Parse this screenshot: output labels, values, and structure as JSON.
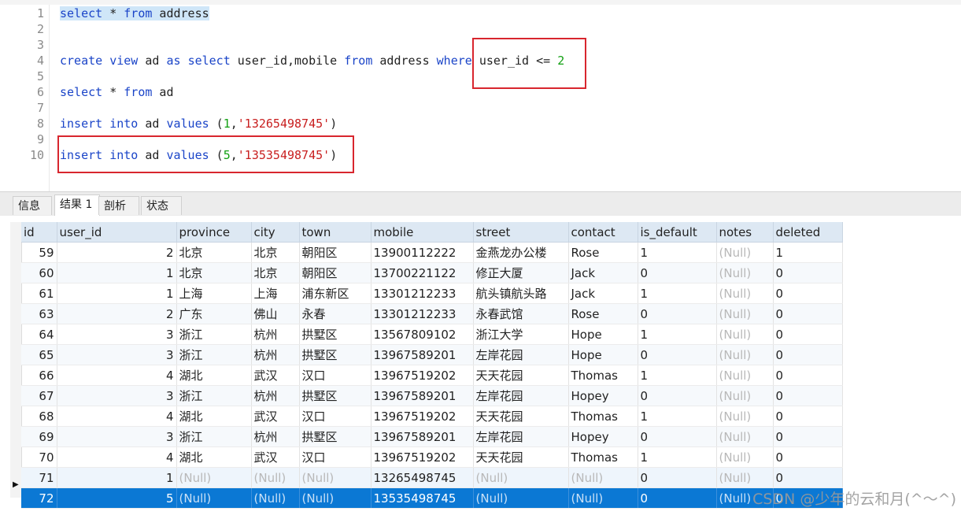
{
  "editor": {
    "lines": [
      {
        "n": "1",
        "segments": [
          [
            "kw",
            "select"
          ],
          [
            "t",
            " * "
          ],
          [
            "kw",
            "from"
          ],
          [
            "t",
            " address"
          ]
        ],
        "highlight": true
      },
      {
        "n": "2",
        "segments": []
      },
      {
        "n": "3",
        "segments": []
      },
      {
        "n": "4",
        "segments": [
          [
            "kw",
            "create"
          ],
          [
            "t",
            " "
          ],
          [
            "kw",
            "view"
          ],
          [
            "t",
            " ad "
          ],
          [
            "kw",
            "as"
          ],
          [
            "t",
            " "
          ],
          [
            "kw",
            "select"
          ],
          [
            "t",
            " user_id,mobile "
          ],
          [
            "kw",
            "from"
          ],
          [
            "t",
            " address "
          ],
          [
            "kw",
            "where"
          ],
          [
            "t",
            " user_id <= "
          ],
          [
            "num",
            "2"
          ]
        ]
      },
      {
        "n": "5",
        "segments": []
      },
      {
        "n": "6",
        "segments": [
          [
            "kw",
            "select"
          ],
          [
            "t",
            " * "
          ],
          [
            "kw",
            "from"
          ],
          [
            "t",
            " ad"
          ]
        ]
      },
      {
        "n": "7",
        "segments": []
      },
      {
        "n": "8",
        "segments": [
          [
            "kw",
            "insert"
          ],
          [
            "t",
            " "
          ],
          [
            "kw",
            "into"
          ],
          [
            "t",
            " ad "
          ],
          [
            "kw",
            "values"
          ],
          [
            "t",
            " ("
          ],
          [
            "num",
            "1"
          ],
          [
            "t",
            ","
          ],
          [
            "str",
            "'13265498745'"
          ],
          [
            "t",
            ")"
          ]
        ]
      },
      {
        "n": "9",
        "segments": []
      },
      {
        "n": "10",
        "segments": [
          [
            "kw",
            "insert"
          ],
          [
            "t",
            " "
          ],
          [
            "kw",
            "into"
          ],
          [
            "t",
            " ad "
          ],
          [
            "kw",
            "values"
          ],
          [
            "t",
            " ("
          ],
          [
            "num",
            "5"
          ],
          [
            "t",
            ","
          ],
          [
            "str",
            "'13535498745'"
          ],
          [
            "t",
            ")"
          ]
        ]
      }
    ]
  },
  "tabs": [
    {
      "label": "信息",
      "active": false
    },
    {
      "label": "结果 1",
      "active": true
    },
    {
      "label": "剖析",
      "active": false
    },
    {
      "label": "状态",
      "active": false
    }
  ],
  "grid": {
    "columns": [
      "id",
      "user_id",
      "province",
      "city",
      "town",
      "mobile",
      "street",
      "contact",
      "is_default",
      "notes",
      "deleted"
    ],
    "rows": [
      [
        "59",
        "2",
        "北京",
        "北京",
        "朝阳区",
        "13900112222",
        "金燕龙办公楼",
        "Rose",
        "1",
        "(Null)",
        "1"
      ],
      [
        "60",
        "1",
        "北京",
        "北京",
        "朝阳区",
        "13700221122",
        "修正大厦",
        "Jack",
        "0",
        "(Null)",
        "0"
      ],
      [
        "61",
        "1",
        "上海",
        "上海",
        "浦东新区",
        "13301212233",
        "航头镇航头路",
        "Jack",
        "1",
        "(Null)",
        "0"
      ],
      [
        "63",
        "2",
        "广东",
        "佛山",
        "永春",
        "13301212233",
        "永春武馆",
        "Rose",
        "0",
        "(Null)",
        "0"
      ],
      [
        "64",
        "3",
        "浙江",
        "杭州",
        "拱墅区",
        "13567809102",
        "浙江大学",
        "Hope",
        "1",
        "(Null)",
        "0"
      ],
      [
        "65",
        "3",
        "浙江",
        "杭州",
        "拱墅区",
        "13967589201",
        "左岸花园",
        "Hope",
        "0",
        "(Null)",
        "0"
      ],
      [
        "66",
        "4",
        "湖北",
        "武汉",
        "汉口",
        "13967519202",
        "天天花园",
        "Thomas",
        "1",
        "(Null)",
        "0"
      ],
      [
        "67",
        "3",
        "浙江",
        "杭州",
        "拱墅区",
        "13967589201",
        "左岸花园",
        "Hopey",
        "0",
        "(Null)",
        "0"
      ],
      [
        "68",
        "4",
        "湖北",
        "武汉",
        "汉口",
        "13967519202",
        "天天花园",
        "Thomas",
        "1",
        "(Null)",
        "0"
      ],
      [
        "69",
        "3",
        "浙江",
        "杭州",
        "拱墅区",
        "13967589201",
        "左岸花园",
        "Hopey",
        "0",
        "(Null)",
        "0"
      ],
      [
        "70",
        "4",
        "湖北",
        "武汉",
        "汉口",
        "13967519202",
        "天天花园",
        "Thomas",
        "1",
        "(Null)",
        "0"
      ],
      [
        "71",
        "1",
        "(Null)",
        "(Null)",
        "(Null)",
        "13265498745",
        "(Null)",
        "(Null)",
        "0",
        "(Null)",
        "0"
      ],
      [
        "72",
        "5",
        "(Null)",
        "(Null)",
        "(Null)",
        "13535498745",
        "(Null)",
        "(Null)",
        "0",
        "(Null)",
        "0"
      ]
    ],
    "selected_row": 12,
    "current_row_marker": "▶"
  },
  "watermark": "CSDN @少年的云和月(^～^)",
  "colors": {
    "keyword": "#1a44c8",
    "number": "#12a012",
    "string": "#c81e1e",
    "annotation_box": "#d8262e",
    "selected_row": "#0b78d4",
    "header_bg": "#dde8f3"
  }
}
